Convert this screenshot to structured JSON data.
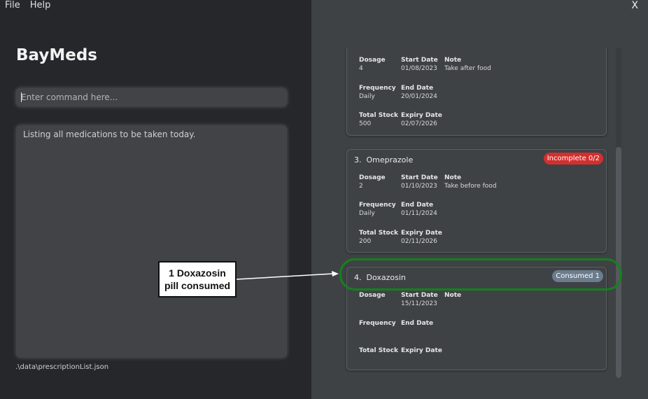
{
  "menu": {
    "file": "File",
    "help": "Help"
  },
  "window": {
    "close": "X"
  },
  "app": {
    "title": "BayMeds"
  },
  "command": {
    "placeholder": "Enter command here..."
  },
  "result": {
    "text": "Listing all medications to be taken today."
  },
  "status": {
    "path": ".\\data\\prescriptionList.json"
  },
  "cards": [
    {
      "index": "",
      "name": "",
      "badge": "",
      "dosage_label": "Dosage",
      "dosage": "4",
      "start_label": "Start Date",
      "start": "01/08/2023",
      "note_label": "Note",
      "note": "Take after food",
      "freq_label": "Frequency",
      "freq": "Daily",
      "end_label": "End Date",
      "end": "20/01/2024",
      "stock_label": "Total Stock",
      "stock": "500",
      "expiry_label": "Expiry Date",
      "expiry": "02/07/2026"
    },
    {
      "index": "3.",
      "name": "Omeprazole",
      "badge": "Incomplete 0/2",
      "dosage_label": "Dosage",
      "dosage": "2",
      "start_label": "Start Date",
      "start": "01/10/2023",
      "note_label": "Note",
      "note": "Take before food",
      "freq_label": "Frequency",
      "freq": "Daily",
      "end_label": "End Date",
      "end": "01/11/2024",
      "stock_label": "Total Stock",
      "stock": "200",
      "expiry_label": "Expiry Date",
      "expiry": "02/11/2026"
    },
    {
      "index": "4.",
      "name": "Doxazosin",
      "badge": "Consumed 1",
      "dosage_label": "Dosage",
      "dosage": "",
      "start_label": "Start Date",
      "start": "15/11/2023",
      "note_label": "Note",
      "note": "",
      "freq_label": "Frequency",
      "freq": "",
      "end_label": "End Date",
      "end": "",
      "stock_label": "Total Stock",
      "stock": "",
      "expiry_label": "Expiry Date",
      "expiry": ""
    }
  ],
  "annotation": {
    "line1": "1 Doxazosin",
    "line2": "pill consumed"
  },
  "colors": {
    "incomplete": "#d32f2f",
    "consumed": "#6b7c8c",
    "highlight": "#14811c"
  }
}
